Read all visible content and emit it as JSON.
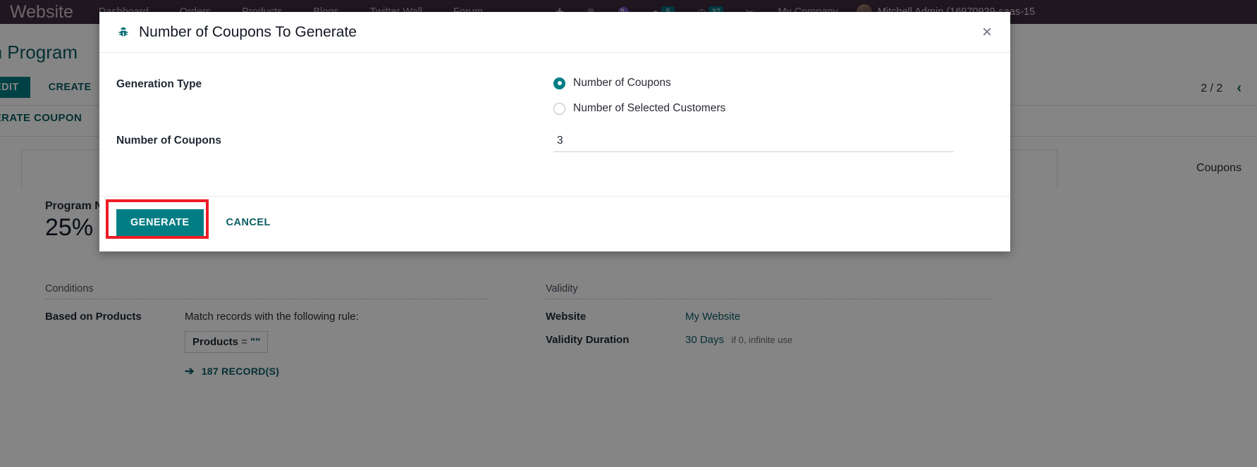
{
  "navbar": {
    "brand": "Website",
    "items": [
      {
        "label": "Dashboard"
      },
      {
        "label": "Orders"
      },
      {
        "label": "Products"
      },
      {
        "label": "Blogs"
      },
      {
        "label": "Twitter Wall"
      },
      {
        "label": "Forum"
      }
    ],
    "icons": [
      {
        "name": "plus-icon",
        "glyph": "✚"
      },
      {
        "name": "bug-icon",
        "glyph": "♛"
      },
      {
        "name": "bell-icon",
        "glyph": "♑"
      }
    ],
    "messages_badge": "5",
    "activities_badge": "37",
    "company": "My Company",
    "user": "Mitchell Admin (16970939-saas-15"
  },
  "control_panel": {
    "breadcrumb": "Coupon Program",
    "edit_label": "EDIT",
    "create_label": "CREATE",
    "pager": "2 / 2",
    "prev_arrow": "‹"
  },
  "action_bar": {
    "generate_coupon_label": "GENERATE COUPON"
  },
  "sheet": {
    "stat_label": "Coupons",
    "program_label": "Program Name",
    "program_value": "25%"
  },
  "conditions": {
    "title": "Conditions",
    "based_on_products_label": "Based on Products",
    "match_text": "Match records with the following rule:",
    "rule_field": "Products",
    "rule_operator": "=",
    "rule_value": "\"\"",
    "records_arrow": "➔",
    "records_label": "187 RECORD(S)"
  },
  "validity": {
    "title": "Validity",
    "website_label": "Website",
    "website_value": "My Website",
    "duration_label": "Validity Duration",
    "duration_value": "30 Days",
    "duration_hint": "if 0, infinite use"
  },
  "modal": {
    "title": "Number of Coupons To Generate",
    "close_glyph": "×",
    "generation_type_label": "Generation Type",
    "options": [
      {
        "label": "Number of Coupons",
        "checked": true
      },
      {
        "label": "Number of Selected Customers",
        "checked": false
      }
    ],
    "number_label": "Number of Coupons",
    "number_value": "3",
    "generate_label": "GENERATE",
    "cancel_label": "CANCEL"
  },
  "colors": {
    "navbar_bg": "#3c2b3d",
    "accent_teal": "#017e84",
    "link_teal": "#0a5c63",
    "highlight_red": "#ee1c25"
  }
}
